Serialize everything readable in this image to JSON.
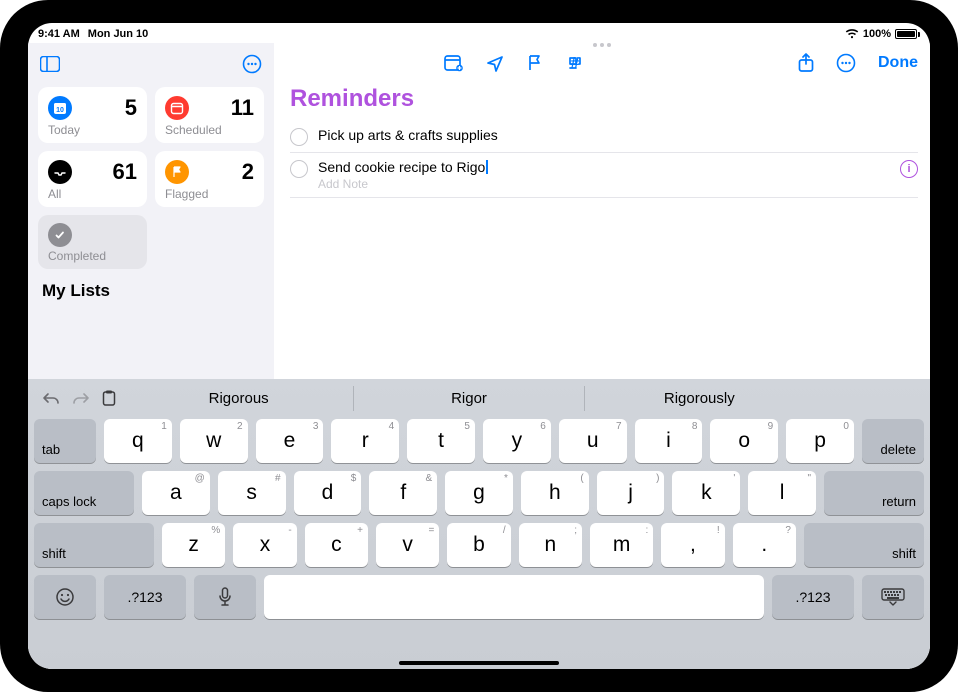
{
  "status": {
    "time": "9:41 AM",
    "date": "Mon Jun 10",
    "battery_pct": "100%"
  },
  "sidebar": {
    "cards": [
      {
        "label": "Today",
        "count": "5"
      },
      {
        "label": "Scheduled",
        "count": "11"
      },
      {
        "label": "All",
        "count": "61"
      },
      {
        "label": "Flagged",
        "count": "2"
      },
      {
        "label": "Completed",
        "count": ""
      }
    ],
    "my_lists_heading": "My Lists"
  },
  "toolbar": {
    "done_label": "Done"
  },
  "list": {
    "title": "Reminders",
    "items": [
      {
        "text": "Pick up arts & crafts supplies",
        "note": "",
        "editing": false
      },
      {
        "text": "Send cookie recipe to Rigo",
        "note": "Add Note",
        "editing": true
      }
    ]
  },
  "keyboard": {
    "suggestions": [
      "Rigorous",
      "Rigor",
      "Rigorously"
    ],
    "row1": {
      "left": "tab",
      "right": "delete",
      "keys": [
        {
          "m": "q",
          "a": "1"
        },
        {
          "m": "w",
          "a": "2"
        },
        {
          "m": "e",
          "a": "3"
        },
        {
          "m": "r",
          "a": "4"
        },
        {
          "m": "t",
          "a": "5"
        },
        {
          "m": "u",
          "a": "7"
        },
        {
          "m": "i",
          "a": "8"
        },
        {
          "m": "o",
          "a": "9"
        },
        {
          "m": "p",
          "a": "0"
        }
      ],
      "key6": {
        "m": "y",
        "a": "6"
      }
    },
    "row2": {
      "left": "caps lock",
      "right": "return",
      "keys": [
        {
          "m": "a",
          "a": "@"
        },
        {
          "m": "s",
          "a": "#"
        },
        {
          "m": "d",
          "a": "$"
        },
        {
          "m": "f",
          "a": "&"
        },
        {
          "m": "g",
          "a": "*"
        },
        {
          "m": "h",
          "a": "("
        },
        {
          "m": "j",
          "a": ")"
        },
        {
          "m": "k",
          "a": "'"
        },
        {
          "m": "l",
          "a": "\""
        }
      ]
    },
    "row3": {
      "left": "shift",
      "right": "shift",
      "keys": [
        {
          "m": "z",
          "a": "%"
        },
        {
          "m": "x",
          "a": "-"
        },
        {
          "m": "c",
          "a": "+"
        },
        {
          "m": "v",
          "a": "="
        },
        {
          "m": "b",
          "a": "/"
        },
        {
          "m": "n",
          "a": ";"
        },
        {
          "m": "m",
          "a": ":"
        },
        {
          "m": ",",
          "a": "!"
        },
        {
          "m": ".",
          "a": "?"
        }
      ]
    },
    "row4": {
      "numsym": ".?123"
    }
  }
}
